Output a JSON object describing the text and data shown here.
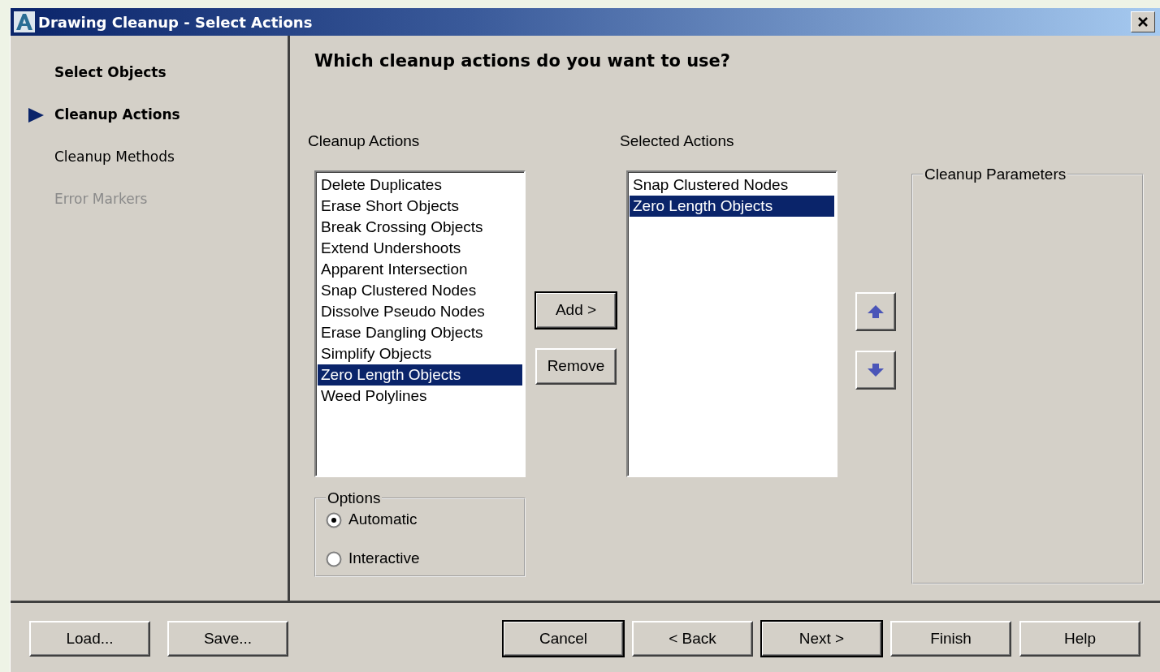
{
  "window": {
    "title": "Drawing Cleanup - Select Actions"
  },
  "steps": [
    {
      "label": "Select Objects",
      "kind": "done"
    },
    {
      "label": "Cleanup Actions",
      "kind": "current"
    },
    {
      "label": "Cleanup Methods",
      "kind": "todo"
    },
    {
      "label": "Error Markers",
      "kind": "disabled"
    }
  ],
  "heading": "Which cleanup actions do you want to use?",
  "available": {
    "label": "Cleanup Actions",
    "items": [
      {
        "text": "Delete Duplicates",
        "selected": false
      },
      {
        "text": "Erase Short Objects",
        "selected": false
      },
      {
        "text": "Break Crossing Objects",
        "selected": false
      },
      {
        "text": "Extend Undershoots",
        "selected": false
      },
      {
        "text": "Apparent Intersection",
        "selected": false
      },
      {
        "text": "Snap Clustered Nodes",
        "selected": false
      },
      {
        "text": "Dissolve Pseudo Nodes",
        "selected": false
      },
      {
        "text": "Erase Dangling Objects",
        "selected": false
      },
      {
        "text": "Simplify Objects",
        "selected": false
      },
      {
        "text": "Zero Length Objects",
        "selected": true
      },
      {
        "text": "Weed Polylines",
        "selected": false
      }
    ]
  },
  "transfer_buttons": [
    {
      "label": "Add >",
      "default": true
    },
    {
      "label": "Remove",
      "default": false
    }
  ],
  "selected_list": {
    "label": "Selected Actions",
    "items": [
      {
        "text": "Snap Clustered Nodes",
        "selected": false
      },
      {
        "text": "Zero Length Objects",
        "selected": true
      }
    ]
  },
  "order_buttons": [
    {
      "kind": "up"
    },
    {
      "kind": "down"
    }
  ],
  "options": {
    "title": "Options",
    "choices": [
      {
        "label": "Automatic",
        "selected": true
      },
      {
        "label": "Interactive",
        "selected": false
      }
    ]
  },
  "parameters": {
    "title": "Cleanup Parameters"
  },
  "footer_left": [
    {
      "label": "Load...",
      "default": false
    },
    {
      "label": "Save...",
      "default": false
    }
  ],
  "footer_right": [
    {
      "label": "Cancel",
      "default": true
    },
    {
      "label": "< Back",
      "default": false
    },
    {
      "label": "Next >",
      "default": true
    },
    {
      "label": "Finish",
      "default": false
    },
    {
      "label": "Help",
      "default": false
    }
  ]
}
